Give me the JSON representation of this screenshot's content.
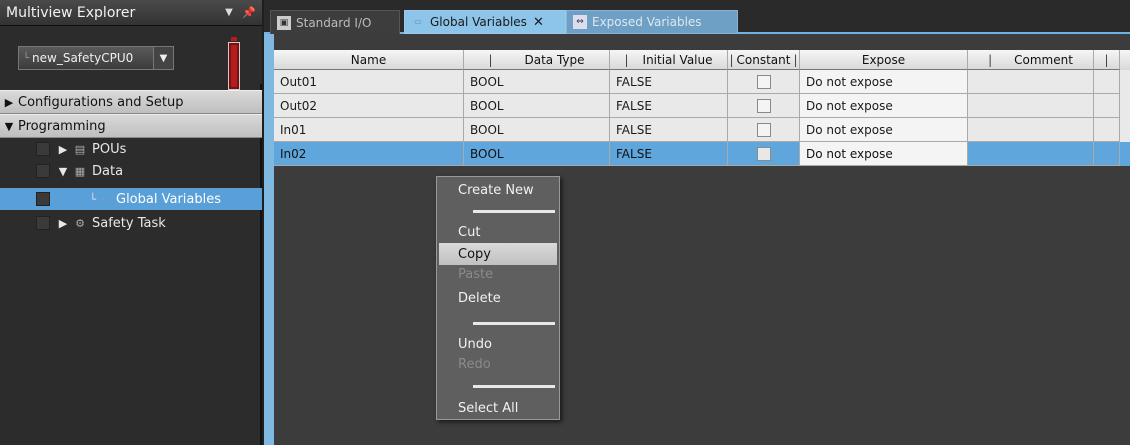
{
  "explorer": {
    "title": "Multiview Explorer",
    "pin_icon": "pin-icon",
    "device": {
      "value": "new_SafetyCPU0",
      "prefix_glyph": "└",
      "status_color": "#b31d1d"
    },
    "sections": [
      {
        "label": "Configurations and Setup",
        "expanded": false
      },
      {
        "label": "Programming",
        "expanded": true
      }
    ],
    "tree": [
      {
        "label": "POUs",
        "icon": "pou-icon"
      },
      {
        "label": "Data",
        "icon": "data-icon"
      },
      {
        "label": "Global Variables",
        "icon": "variables-icon",
        "selected": true
      },
      {
        "label": "Safety Task",
        "icon": "task-icon"
      }
    ]
  },
  "tabs": [
    {
      "label": "Standard I/O",
      "icon": "io-icon",
      "state": "inactive"
    },
    {
      "label": "Global Variables",
      "icon": "variables-icon",
      "state": "active",
      "closable": true
    },
    {
      "label": "Exposed Variables",
      "icon": "exposed-icon",
      "state": "inactive"
    }
  ],
  "grid": {
    "columns": [
      "Name",
      "Data Type",
      "Initial Value",
      "Constant",
      "Expose",
      "Comment",
      ""
    ],
    "header_bars": [
      "|",
      "|",
      "|",
      "|",
      "|",
      "|"
    ],
    "rows": [
      {
        "name": "Out01",
        "type": "BOOL",
        "init": "FALSE",
        "constant": false,
        "expose": "Do not expose",
        "comment": "",
        "selected": false
      },
      {
        "name": "Out02",
        "type": "BOOL",
        "init": "FALSE",
        "constant": false,
        "expose": "Do not expose",
        "comment": "",
        "selected": false
      },
      {
        "name": "In01",
        "type": "BOOL",
        "init": "FALSE",
        "constant": false,
        "expose": "Do not expose",
        "comment": "",
        "selected": false
      },
      {
        "name": "In02",
        "type": "BOOL",
        "init": "FALSE",
        "constant": false,
        "expose": "Do not expose",
        "comment": "",
        "selected": true
      }
    ]
  },
  "context_menu": {
    "items": [
      {
        "label": "Create New",
        "enabled": true
      },
      {
        "label": "Cut",
        "enabled": true
      },
      {
        "label": "Copy",
        "enabled": true,
        "hovered": true
      },
      {
        "label": "Paste",
        "enabled": false
      },
      {
        "label": "Delete",
        "enabled": true
      },
      {
        "label": "Undo",
        "enabled": true
      },
      {
        "label": "Redo",
        "enabled": false
      },
      {
        "label": "Select All",
        "enabled": true
      }
    ]
  },
  "colors": {
    "accent": "#6fb2e3",
    "selection": "#5ea6dc",
    "panel": "#2c2c2c"
  }
}
